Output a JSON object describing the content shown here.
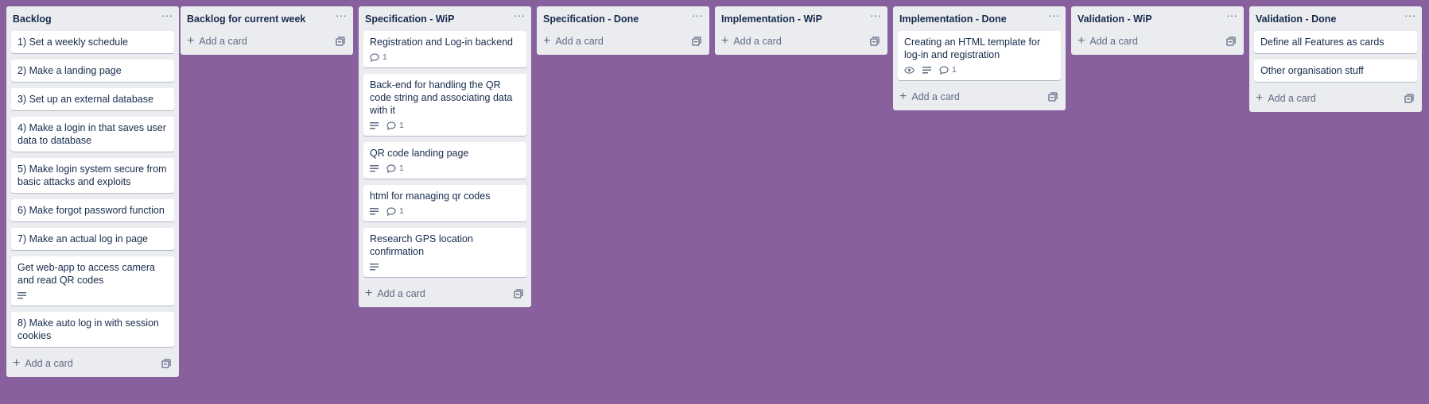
{
  "lists": [
    {
      "title": "Backlog",
      "cards": [
        {
          "title": "1) Set a weekly schedule"
        },
        {
          "title": "2) Make a landing page"
        },
        {
          "title": "3) Set up an external database"
        },
        {
          "title": "4) Make a login in that saves user data to database"
        },
        {
          "title": "5) Make login system secure from basic attacks and exploits"
        },
        {
          "title": "6) Make forgot password function"
        },
        {
          "title": "7) Make an actual log in page"
        },
        {
          "title": "Get web-app to access camera and read QR codes",
          "description": true
        },
        {
          "title": "8) Make auto log in with session cookies"
        }
      ],
      "add_card": "Add a card"
    },
    {
      "title": "Backlog for current week",
      "cards": [],
      "add_card": "Add a card"
    },
    {
      "title": "Specification - WiP",
      "cards": [
        {
          "title": "Registration and Log-in backend",
          "comments": "1"
        },
        {
          "title": "Back-end for handling the QR code string and associating data with it",
          "description": true,
          "comments": "1"
        },
        {
          "title": "QR code landing page",
          "description": true,
          "comments": "1"
        },
        {
          "title": "html for managing qr codes",
          "description": true,
          "comments": "1"
        },
        {
          "title": "Research GPS location confirmation",
          "description": true
        }
      ],
      "add_card": "Add a card"
    },
    {
      "title": "Specification - Done",
      "cards": [],
      "add_card": "Add a card"
    },
    {
      "title": "Implementation - WiP",
      "cards": [],
      "add_card": "Add a card"
    },
    {
      "title": "Implementation - Done",
      "cards": [
        {
          "title": "Creating an HTML template for log-in and registration",
          "watch": true,
          "description": true,
          "comments": "1"
        }
      ],
      "add_card": "Add a card"
    },
    {
      "title": "Validation - WiP",
      "cards": [],
      "add_card": "Add a card"
    },
    {
      "title": "Validation - Done",
      "cards": [
        {
          "title": "Define all Features as cards"
        },
        {
          "title": "Other organisation stuff"
        }
      ],
      "add_card": "Add a card"
    }
  ],
  "colors": {
    "board_background": "#89609e",
    "list_background": "#ebecf0",
    "card_background": "#ffffff",
    "text": "#172b4d",
    "muted": "#5e6c84"
  },
  "icons": {
    "list_menu": "ellipsis-icon",
    "add": "plus-icon",
    "template": "card-template-icon",
    "description": "description-icon",
    "comments": "comment-icon",
    "watch": "eye-icon"
  }
}
